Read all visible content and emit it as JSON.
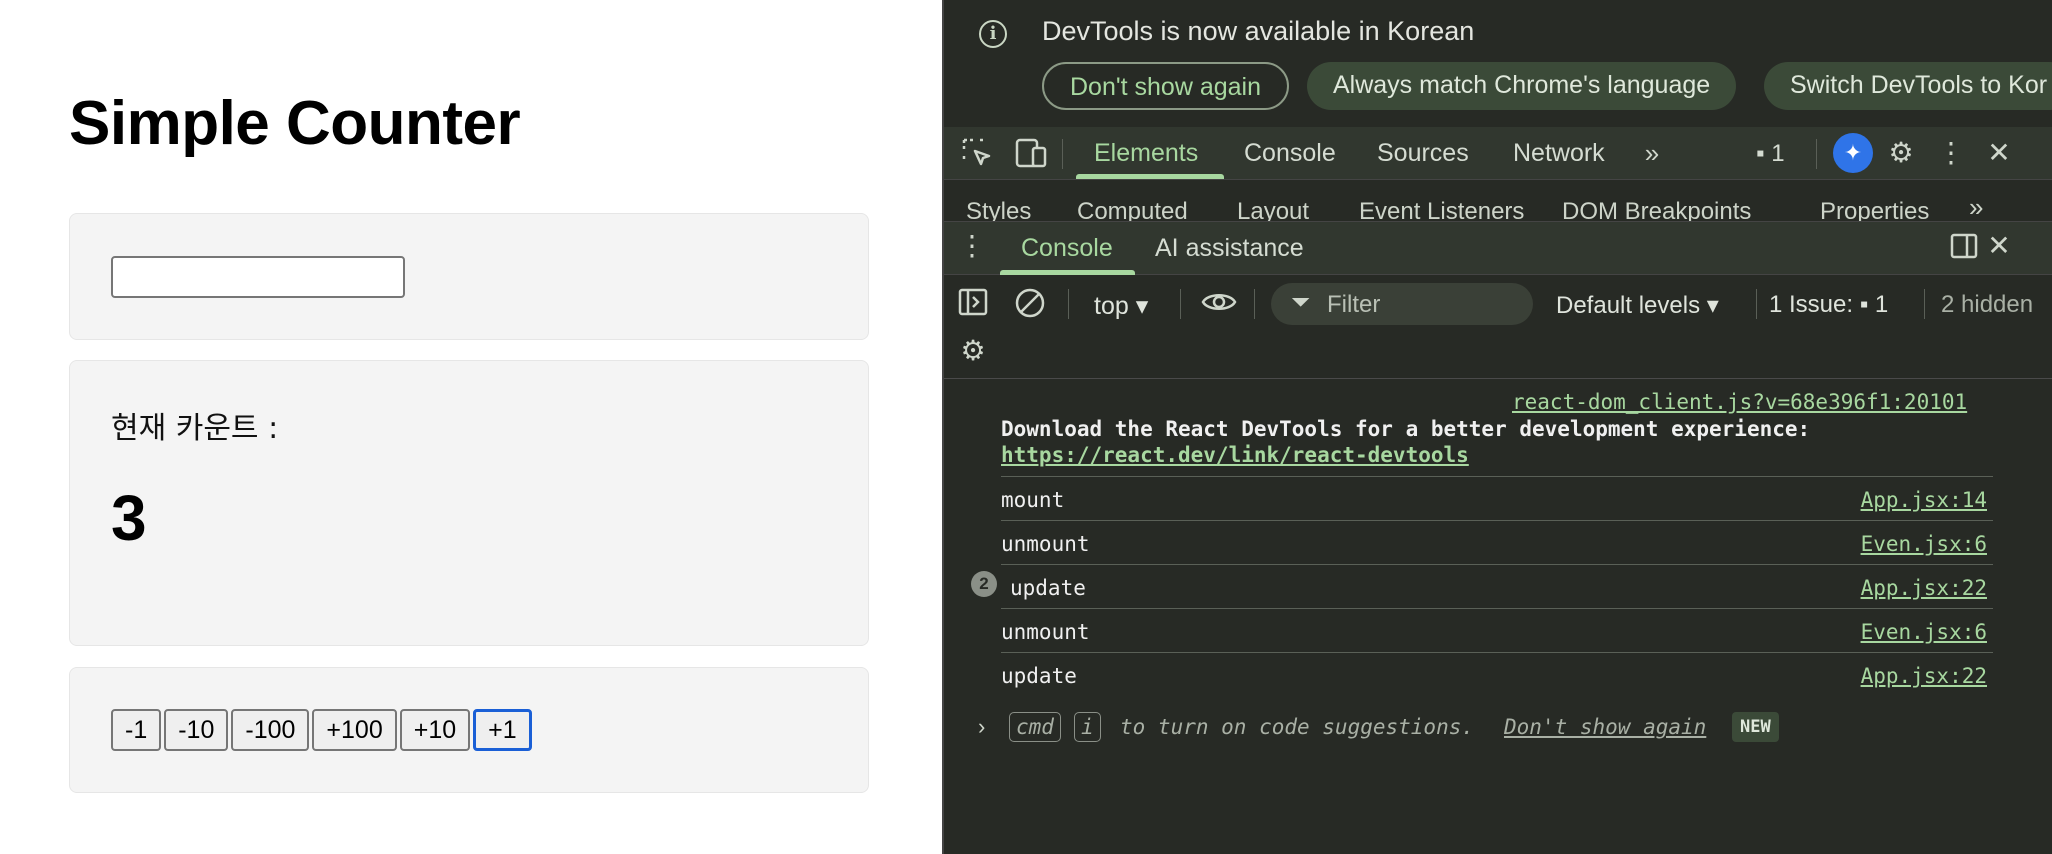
{
  "app": {
    "title": "Simple Counter",
    "input_value": "",
    "count_label": "현재 카운트 :",
    "count_value": "3",
    "buttons": [
      "-1",
      "-10",
      "-100",
      "+100",
      "+10",
      "+1"
    ]
  },
  "devtools": {
    "infobar": {
      "message": "DevTools is now available in Korean",
      "dont_show": "Don't show again",
      "always_match": "Always match Chrome's language",
      "switch": "Switch DevTools to Kor"
    },
    "tabs": [
      "Elements",
      "Console",
      "Sources",
      "Network"
    ],
    "message_count": "1",
    "subtabs": [
      "Styles",
      "Computed",
      "Layout",
      "Event Listeners",
      "DOM Breakpoints",
      "Properties"
    ],
    "drawer": {
      "console": "Console",
      "ai": "AI assistance"
    },
    "toolbar": {
      "context": "top ▾",
      "filter_placeholder": "Filter",
      "levels": "Default levels ▾",
      "issue": "1 Issue: ",
      "issue_count": "1",
      "hidden": "2 hidden"
    },
    "console": {
      "react_source": "react-dom_client.js?v=68e396f1:20101",
      "react_message": "Download the React DevTools for a better development experience:",
      "react_link": "https://react.dev/link/react-devtools",
      "rows": [
        {
          "msg": "mount",
          "src": "App.jsx:14"
        },
        {
          "msg": "unmount",
          "src": "Even.jsx:6"
        },
        {
          "msg": "update",
          "src": "App.jsx:22",
          "repeat": "2"
        },
        {
          "msg": "unmount",
          "src": "Even.jsx:6"
        },
        {
          "msg": "update",
          "src": "App.jsx:22"
        }
      ],
      "hint_cmd": "cmd",
      "hint_i": "i",
      "hint_text": "to turn on code suggestions.",
      "hint_link": "Don't show again",
      "new_badge": "NEW"
    }
  },
  "colors": {
    "accent_green": "#a8d8a0",
    "focus_blue": "#1a5fd6",
    "devtools_bg": "#272a25"
  }
}
